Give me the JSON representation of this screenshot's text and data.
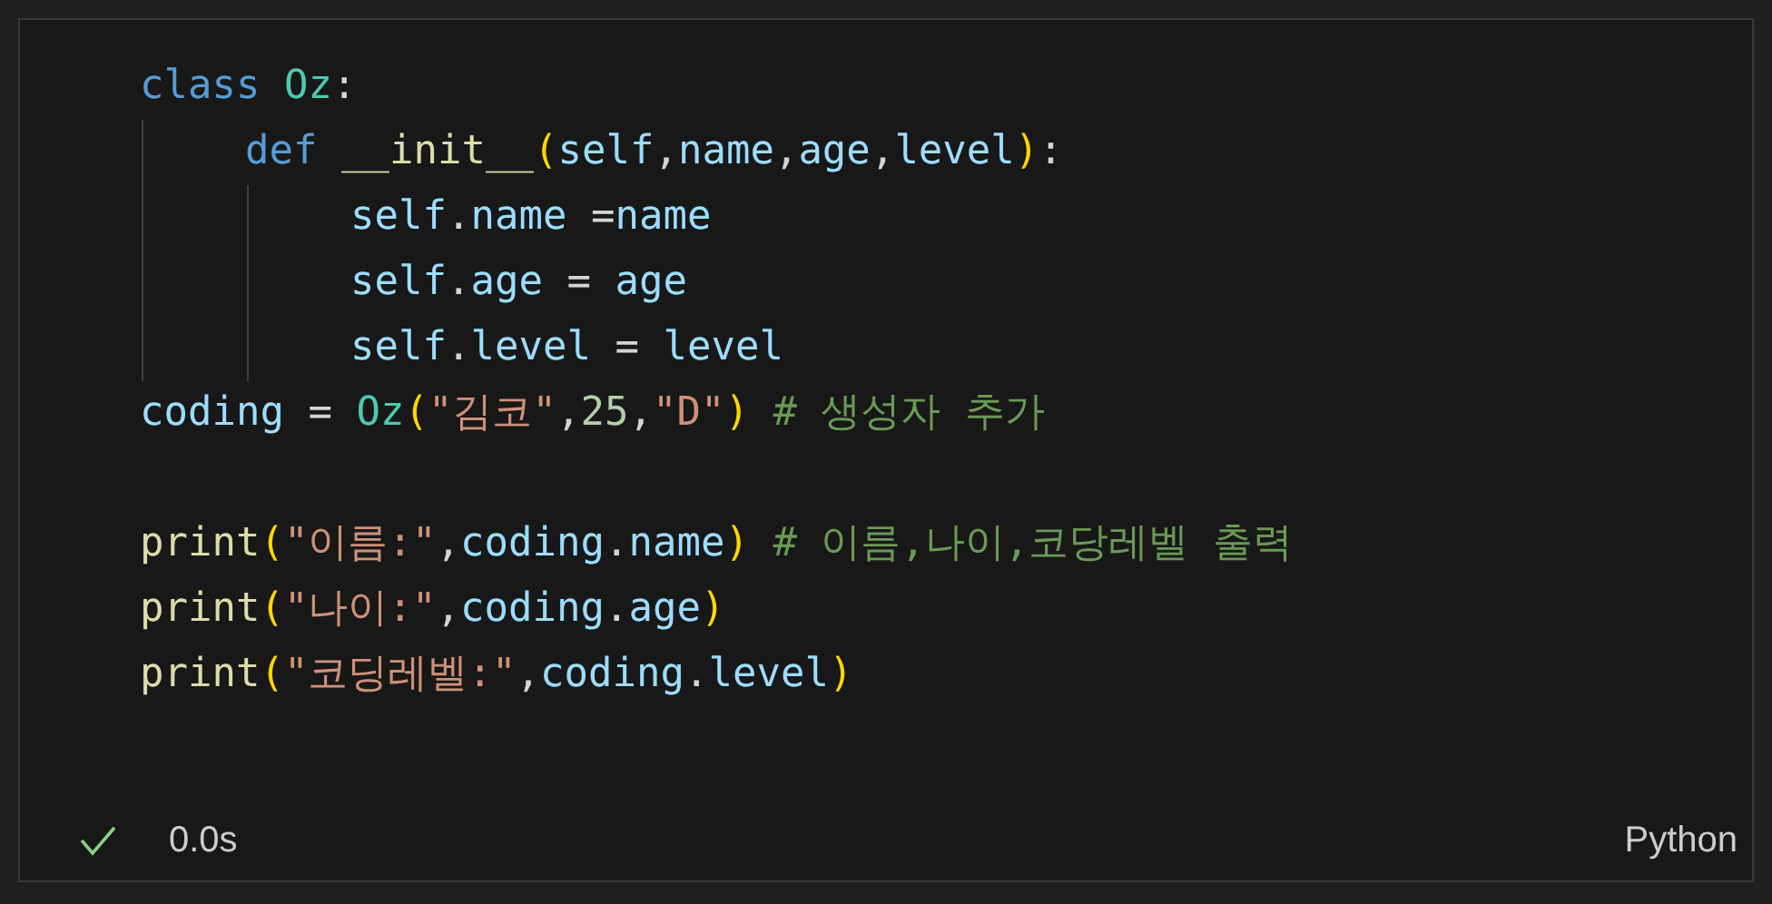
{
  "cell": {
    "lines": [
      {
        "kind": "code",
        "tokens": [
          {
            "kind": "keyword",
            "text": "class"
          },
          {
            "kind": "class",
            "text": " Oz"
          },
          {
            "kind": "plain",
            "text": ":"
          }
        ],
        "children": [
          {
            "kind": "code",
            "tokens": [
              {
                "kind": "keyword",
                "text": "def"
              },
              {
                "kind": "func",
                "text": " __init__"
              },
              {
                "kind": "paren",
                "text": "("
              },
              {
                "kind": "var",
                "text": "self"
              },
              {
                "kind": "plain",
                "text": ","
              },
              {
                "kind": "var",
                "text": "name"
              },
              {
                "kind": "plain",
                "text": ","
              },
              {
                "kind": "var",
                "text": "age"
              },
              {
                "kind": "plain",
                "text": ","
              },
              {
                "kind": "var",
                "text": "level"
              },
              {
                "kind": "paren",
                "text": ")"
              },
              {
                "kind": "plain",
                "text": ":"
              }
            ],
            "children": [
              {
                "kind": "code",
                "tokens": [
                  {
                    "kind": "var",
                    "text": "self"
                  },
                  {
                    "kind": "plain",
                    "text": "."
                  },
                  {
                    "kind": "var",
                    "text": "name"
                  },
                  {
                    "kind": "plain",
                    "text": " ="
                  },
                  {
                    "kind": "var",
                    "text": "name"
                  }
                ]
              },
              {
                "kind": "code",
                "tokens": [
                  {
                    "kind": "var",
                    "text": "self"
                  },
                  {
                    "kind": "plain",
                    "text": "."
                  },
                  {
                    "kind": "var",
                    "text": "age"
                  },
                  {
                    "kind": "plain",
                    "text": " = "
                  },
                  {
                    "kind": "var",
                    "text": "age"
                  }
                ]
              },
              {
                "kind": "code",
                "tokens": [
                  {
                    "kind": "var",
                    "text": "self"
                  },
                  {
                    "kind": "plain",
                    "text": "."
                  },
                  {
                    "kind": "var",
                    "text": "level"
                  },
                  {
                    "kind": "plain",
                    "text": " = "
                  },
                  {
                    "kind": "var",
                    "text": "level"
                  }
                ]
              }
            ]
          }
        ]
      },
      {
        "kind": "code",
        "tokens": [
          {
            "kind": "var",
            "text": "coding"
          },
          {
            "kind": "plain",
            "text": " = "
          },
          {
            "kind": "class",
            "text": "Oz"
          },
          {
            "kind": "paren",
            "text": "("
          },
          {
            "kind": "string",
            "text": "\"김코\""
          },
          {
            "kind": "plain",
            "text": ","
          },
          {
            "kind": "number",
            "text": "25"
          },
          {
            "kind": "plain",
            "text": ","
          },
          {
            "kind": "string",
            "text": "\"D\""
          },
          {
            "kind": "paren",
            "text": ")"
          },
          {
            "kind": "comment",
            "text": " # 생성자 추가"
          }
        ]
      },
      {
        "kind": "blank"
      },
      {
        "kind": "code",
        "tokens": [
          {
            "kind": "func",
            "text": "print"
          },
          {
            "kind": "paren",
            "text": "("
          },
          {
            "kind": "string",
            "text": "\"이름:\""
          },
          {
            "kind": "plain",
            "text": ","
          },
          {
            "kind": "var",
            "text": "coding"
          },
          {
            "kind": "plain",
            "text": "."
          },
          {
            "kind": "var",
            "text": "name"
          },
          {
            "kind": "paren",
            "text": ")"
          },
          {
            "kind": "comment",
            "text": " # 이름,나이,코당레벨 출력"
          }
        ]
      },
      {
        "kind": "code",
        "tokens": [
          {
            "kind": "func",
            "text": "print"
          },
          {
            "kind": "paren",
            "text": "("
          },
          {
            "kind": "string",
            "text": "\"나이:\""
          },
          {
            "kind": "plain",
            "text": ","
          },
          {
            "kind": "var",
            "text": "coding"
          },
          {
            "kind": "plain",
            "text": "."
          },
          {
            "kind": "var",
            "text": "age"
          },
          {
            "kind": "paren",
            "text": ")"
          }
        ]
      },
      {
        "kind": "code",
        "tokens": [
          {
            "kind": "func",
            "text": "print"
          },
          {
            "kind": "paren",
            "text": "("
          },
          {
            "kind": "string",
            "text": "\"코딩레벨:\""
          },
          {
            "kind": "plain",
            "text": ","
          },
          {
            "kind": "var",
            "text": "coding"
          },
          {
            "kind": "plain",
            "text": "."
          },
          {
            "kind": "var",
            "text": "level"
          },
          {
            "kind": "paren",
            "text": ")"
          }
        ]
      }
    ]
  },
  "status": {
    "succeeded": true,
    "duration": "0.0s",
    "language": "Python"
  }
}
